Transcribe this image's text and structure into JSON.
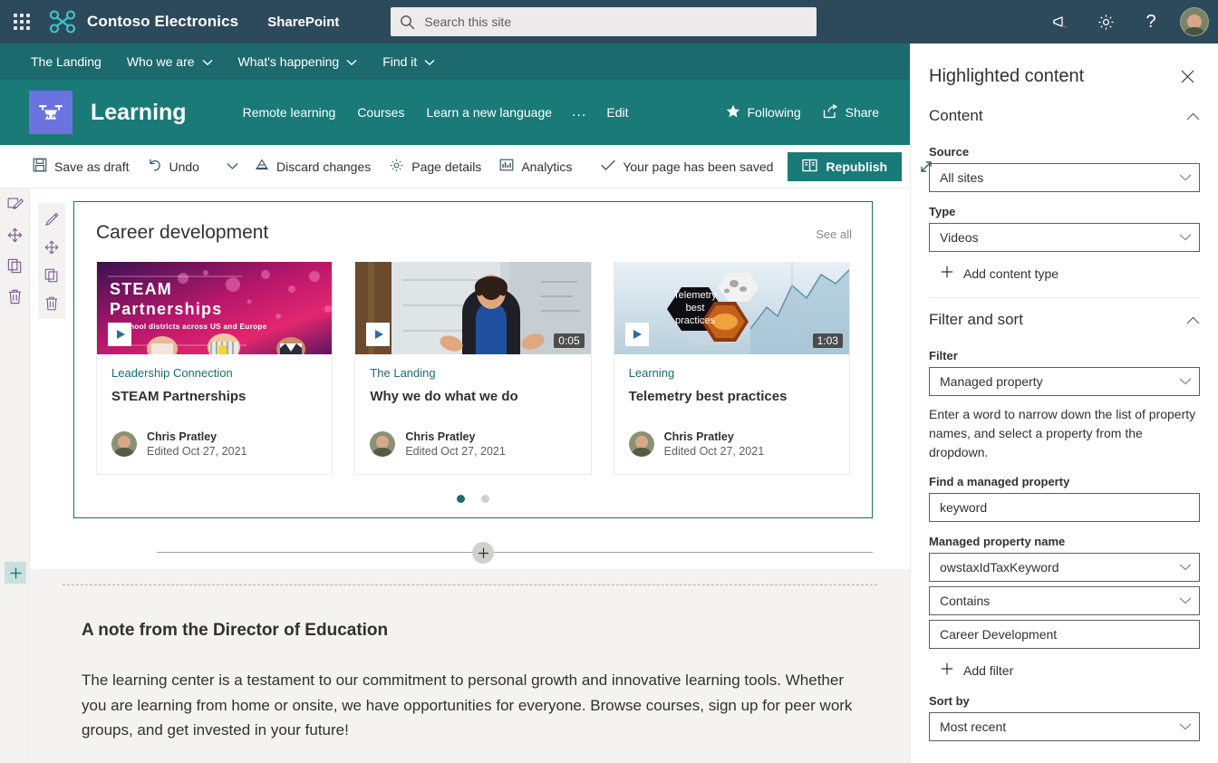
{
  "suite": {
    "waffle_label": "app-launcher",
    "brand": "Contoso Electronics",
    "app": "SharePoint",
    "search_placeholder": "Search this site",
    "search_value": "",
    "icons": [
      "megaphone-icon",
      "gear-icon",
      "help-icon"
    ],
    "bg": "#2d4a5c"
  },
  "hub_nav": {
    "items": [
      {
        "label": "The Landing",
        "has_chevron": false
      },
      {
        "label": "Who we are",
        "has_chevron": true
      },
      {
        "label": "What's happening",
        "has_chevron": true
      },
      {
        "label": "Find it",
        "has_chevron": true
      }
    ],
    "bg": "#1d6a6e"
  },
  "site_header": {
    "title": "Learning",
    "logo_icon": "drone-icon",
    "logo_bg": "#6b73e0",
    "bg": "#197a78",
    "nav": [
      {
        "label": "Remote learning"
      },
      {
        "label": "Courses"
      },
      {
        "label": "Learn a new language"
      },
      {
        "label": "..."
      },
      {
        "label": "Edit"
      }
    ],
    "following_label": "Following",
    "share_label": "Share"
  },
  "command_bar": {
    "save_draft": "Save as draft",
    "undo": "Undo",
    "discard": "Discard changes",
    "page_details": "Page details",
    "analytics": "Analytics",
    "status": "Your page has been saved",
    "republish": "Republish",
    "republish_bg": "#197a78"
  },
  "rails": {
    "outer": [
      "edit-icon",
      "move-icon",
      "duplicate-icon",
      "delete-icon"
    ],
    "inner": [
      "pencil-icon",
      "move-icon",
      "duplicate-icon",
      "delete-icon"
    ],
    "add_section": "add-section-icon"
  },
  "webpart": {
    "title": "Career development",
    "see_all": "See all",
    "border_color": "#1d6a6e",
    "cards": [
      {
        "site": "Leadership Connection",
        "name": "STEAM Partnerships",
        "author": "Chris Pratley",
        "edited": "Edited Oct 27, 2021",
        "duration": "",
        "thumb": "steam-partnerships-thumbnail",
        "thumb_heading": "STEAM",
        "thumb_heading2": "Partnerships",
        "thumb_sub": "40 school districts across US and Europe"
      },
      {
        "site": "The Landing",
        "name": "Why we do what we do",
        "author": "Chris Pratley",
        "edited": "Edited Oct 27, 2021",
        "duration": "0:05",
        "thumb": "presenter-video-thumbnail"
      },
      {
        "site": "Learning",
        "name": "Telemetry best practices",
        "author": "Chris Pratley",
        "edited": "Edited Oct 27, 2021",
        "duration": "1:03",
        "thumb": "telemetry-best-practices-thumbnail",
        "thumb_heading": "Telemetry",
        "thumb_heading2": "best",
        "thumb_heading3": "practices"
      }
    ],
    "pager": {
      "count": 2,
      "active_index": 0
    }
  },
  "note": {
    "title": "A note from the Director of Education",
    "body": "The learning center is a testament to our commitment to personal growth and innovative learning tools. Whether you are learning from home or onsite, we have opportunities for everyone. Browse courses, sign up for peer work groups, and get invested in your future!"
  },
  "panel": {
    "title": "Highlighted content",
    "close_icon": "close-icon",
    "content_section": {
      "heading": "Content",
      "source_label": "Source",
      "source_value": "All sites",
      "type_label": "Type",
      "type_value": "Videos",
      "add_content_type": "Add content type"
    },
    "filter_section": {
      "heading": "Filter and sort",
      "filter_label": "Filter",
      "filter_value": "Managed property",
      "helper": "Enter a word to narrow down the list of property names, and select a property from the dropdown.",
      "find_label": "Find a managed property",
      "find_value": "keyword",
      "managed_name_label": "Managed property name",
      "managed_name_value": "owstaxIdTaxKeyword",
      "operator_value": "Contains",
      "operand_value": "Career Development",
      "add_filter": "Add filter",
      "sort_label": "Sort by",
      "sort_value": "Most recent"
    }
  }
}
